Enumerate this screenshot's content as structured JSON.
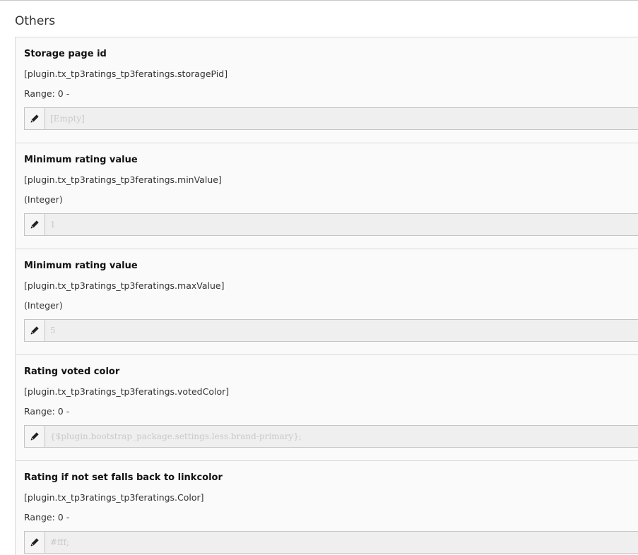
{
  "section": {
    "title": "Others"
  },
  "fields": [
    {
      "label": "Storage page id",
      "key": "[plugin.tx_tp3ratings_tp3feratings.storagePid]",
      "meta": "Range: 0 -",
      "placeholder": "[Empty]"
    },
    {
      "label": "Minimum rating value",
      "key": "[plugin.tx_tp3ratings_tp3feratings.minValue]",
      "meta": "(Integer)",
      "placeholder": "1"
    },
    {
      "label": "Minimum rating value",
      "key": "[plugin.tx_tp3ratings_tp3feratings.maxValue]",
      "meta": "(Integer)",
      "placeholder": "5"
    },
    {
      "label": "Rating voted color",
      "key": "[plugin.tx_tp3ratings_tp3feratings.votedColor]",
      "meta": "Range: 0 -",
      "placeholder": "{$plugin.bootstrap_package.settings.less.brand-primary};"
    },
    {
      "label": "Rating if not set falls back to linkcolor",
      "key": "[plugin.tx_tp3ratings_tp3feratings.Color]",
      "meta": "Range: 0 -",
      "placeholder": "#fff;"
    }
  ],
  "icons": {
    "edit": "pencil-icon"
  }
}
